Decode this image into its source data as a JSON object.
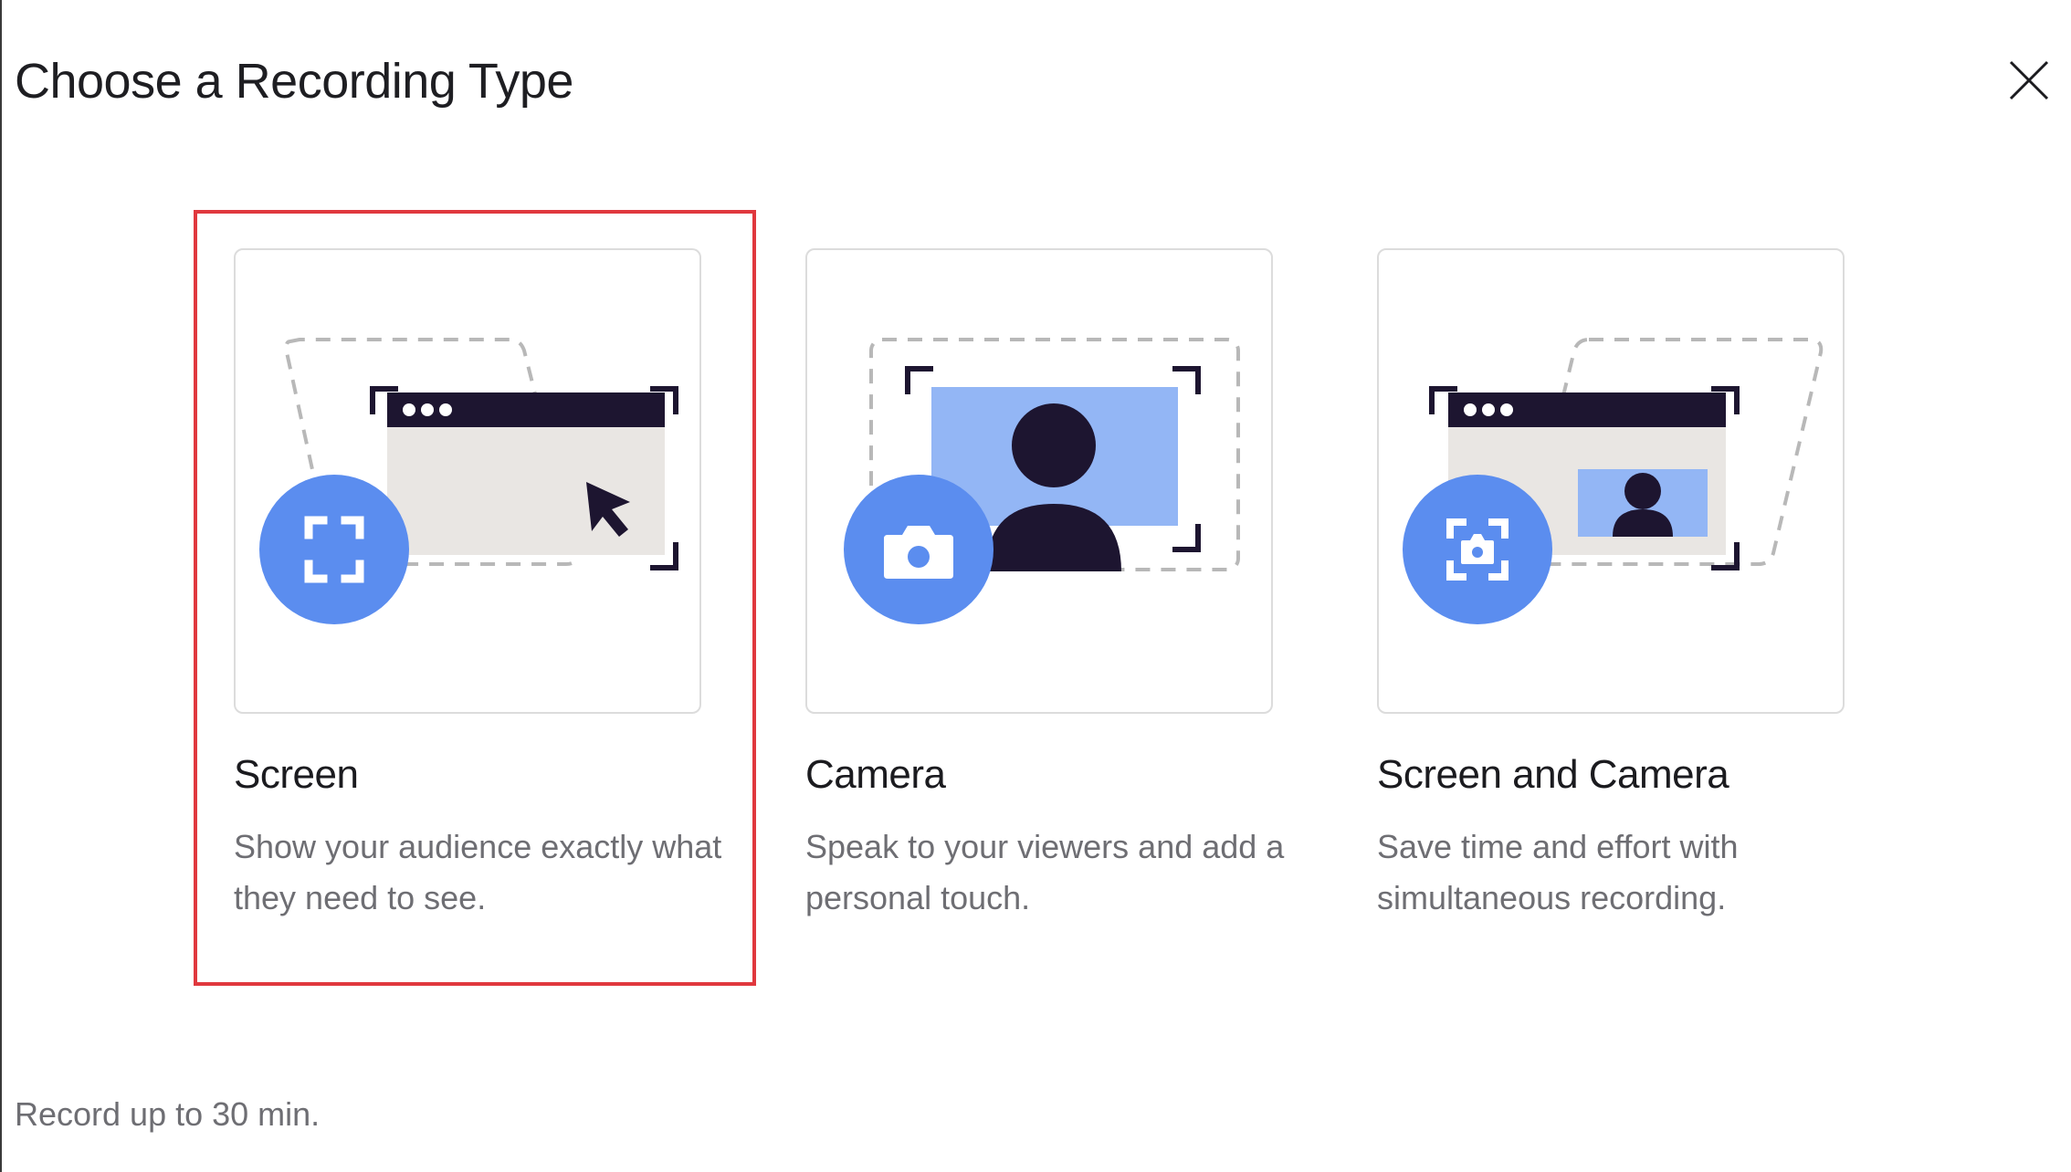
{
  "dialog": {
    "title": "Choose a Recording Type",
    "close_icon": "close-icon",
    "footer_note": "Record up to 30 min."
  },
  "options": [
    {
      "title": "Screen",
      "description": "Show your audience exactly what they need to see.",
      "selected": true,
      "icon": "screen-capture-icon"
    },
    {
      "title": "Camera",
      "description": "Speak to your viewers and add a personal touch.",
      "selected": false,
      "icon": "camera-icon"
    },
    {
      "title": "Screen and Camera",
      "description": "Save time and effort with simultaneous recording.",
      "selected": false,
      "icon": "screen-camera-icon"
    }
  ],
  "colors": {
    "accent_blue": "#5b8def",
    "light_blue": "#93b6f5",
    "dark_navy": "#1d1530",
    "window_gray": "#e9e6e3",
    "selection_red": "#e0383e"
  }
}
